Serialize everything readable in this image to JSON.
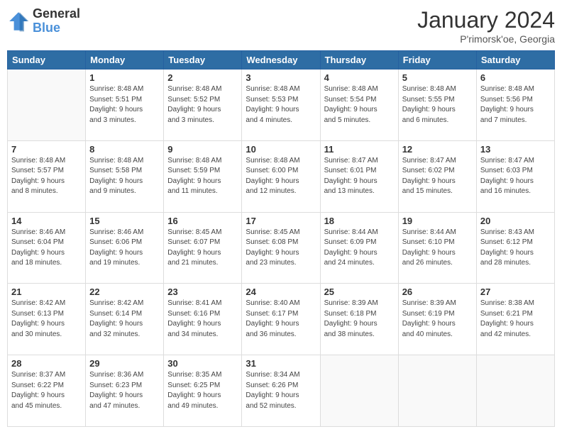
{
  "header": {
    "logo_general": "General",
    "logo_blue": "Blue",
    "month_title": "January 2024",
    "location": "P'rimorsk'oe, Georgia"
  },
  "weekdays": [
    "Sunday",
    "Monday",
    "Tuesday",
    "Wednesday",
    "Thursday",
    "Friday",
    "Saturday"
  ],
  "weeks": [
    [
      {
        "day": "",
        "info": ""
      },
      {
        "day": "1",
        "info": "Sunrise: 8:48 AM\nSunset: 5:51 PM\nDaylight: 9 hours\nand 3 minutes."
      },
      {
        "day": "2",
        "info": "Sunrise: 8:48 AM\nSunset: 5:52 PM\nDaylight: 9 hours\nand 3 minutes."
      },
      {
        "day": "3",
        "info": "Sunrise: 8:48 AM\nSunset: 5:53 PM\nDaylight: 9 hours\nand 4 minutes."
      },
      {
        "day": "4",
        "info": "Sunrise: 8:48 AM\nSunset: 5:54 PM\nDaylight: 9 hours\nand 5 minutes."
      },
      {
        "day": "5",
        "info": "Sunrise: 8:48 AM\nSunset: 5:55 PM\nDaylight: 9 hours\nand 6 minutes."
      },
      {
        "day": "6",
        "info": "Sunrise: 8:48 AM\nSunset: 5:56 PM\nDaylight: 9 hours\nand 7 minutes."
      }
    ],
    [
      {
        "day": "7",
        "info": "Sunrise: 8:48 AM\nSunset: 5:57 PM\nDaylight: 9 hours\nand 8 minutes."
      },
      {
        "day": "8",
        "info": "Sunrise: 8:48 AM\nSunset: 5:58 PM\nDaylight: 9 hours\nand 9 minutes."
      },
      {
        "day": "9",
        "info": "Sunrise: 8:48 AM\nSunset: 5:59 PM\nDaylight: 9 hours\nand 11 minutes."
      },
      {
        "day": "10",
        "info": "Sunrise: 8:48 AM\nSunset: 6:00 PM\nDaylight: 9 hours\nand 12 minutes."
      },
      {
        "day": "11",
        "info": "Sunrise: 8:47 AM\nSunset: 6:01 PM\nDaylight: 9 hours\nand 13 minutes."
      },
      {
        "day": "12",
        "info": "Sunrise: 8:47 AM\nSunset: 6:02 PM\nDaylight: 9 hours\nand 15 minutes."
      },
      {
        "day": "13",
        "info": "Sunrise: 8:47 AM\nSunset: 6:03 PM\nDaylight: 9 hours\nand 16 minutes."
      }
    ],
    [
      {
        "day": "14",
        "info": "Sunrise: 8:46 AM\nSunset: 6:04 PM\nDaylight: 9 hours\nand 18 minutes."
      },
      {
        "day": "15",
        "info": "Sunrise: 8:46 AM\nSunset: 6:06 PM\nDaylight: 9 hours\nand 19 minutes."
      },
      {
        "day": "16",
        "info": "Sunrise: 8:45 AM\nSunset: 6:07 PM\nDaylight: 9 hours\nand 21 minutes."
      },
      {
        "day": "17",
        "info": "Sunrise: 8:45 AM\nSunset: 6:08 PM\nDaylight: 9 hours\nand 23 minutes."
      },
      {
        "day": "18",
        "info": "Sunrise: 8:44 AM\nSunset: 6:09 PM\nDaylight: 9 hours\nand 24 minutes."
      },
      {
        "day": "19",
        "info": "Sunrise: 8:44 AM\nSunset: 6:10 PM\nDaylight: 9 hours\nand 26 minutes."
      },
      {
        "day": "20",
        "info": "Sunrise: 8:43 AM\nSunset: 6:12 PM\nDaylight: 9 hours\nand 28 minutes."
      }
    ],
    [
      {
        "day": "21",
        "info": "Sunrise: 8:42 AM\nSunset: 6:13 PM\nDaylight: 9 hours\nand 30 minutes."
      },
      {
        "day": "22",
        "info": "Sunrise: 8:42 AM\nSunset: 6:14 PM\nDaylight: 9 hours\nand 32 minutes."
      },
      {
        "day": "23",
        "info": "Sunrise: 8:41 AM\nSunset: 6:16 PM\nDaylight: 9 hours\nand 34 minutes."
      },
      {
        "day": "24",
        "info": "Sunrise: 8:40 AM\nSunset: 6:17 PM\nDaylight: 9 hours\nand 36 minutes."
      },
      {
        "day": "25",
        "info": "Sunrise: 8:39 AM\nSunset: 6:18 PM\nDaylight: 9 hours\nand 38 minutes."
      },
      {
        "day": "26",
        "info": "Sunrise: 8:39 AM\nSunset: 6:19 PM\nDaylight: 9 hours\nand 40 minutes."
      },
      {
        "day": "27",
        "info": "Sunrise: 8:38 AM\nSunset: 6:21 PM\nDaylight: 9 hours\nand 42 minutes."
      }
    ],
    [
      {
        "day": "28",
        "info": "Sunrise: 8:37 AM\nSunset: 6:22 PM\nDaylight: 9 hours\nand 45 minutes."
      },
      {
        "day": "29",
        "info": "Sunrise: 8:36 AM\nSunset: 6:23 PM\nDaylight: 9 hours\nand 47 minutes."
      },
      {
        "day": "30",
        "info": "Sunrise: 8:35 AM\nSunset: 6:25 PM\nDaylight: 9 hours\nand 49 minutes."
      },
      {
        "day": "31",
        "info": "Sunrise: 8:34 AM\nSunset: 6:26 PM\nDaylight: 9 hours\nand 52 minutes."
      },
      {
        "day": "",
        "info": ""
      },
      {
        "day": "",
        "info": ""
      },
      {
        "day": "",
        "info": ""
      }
    ]
  ]
}
